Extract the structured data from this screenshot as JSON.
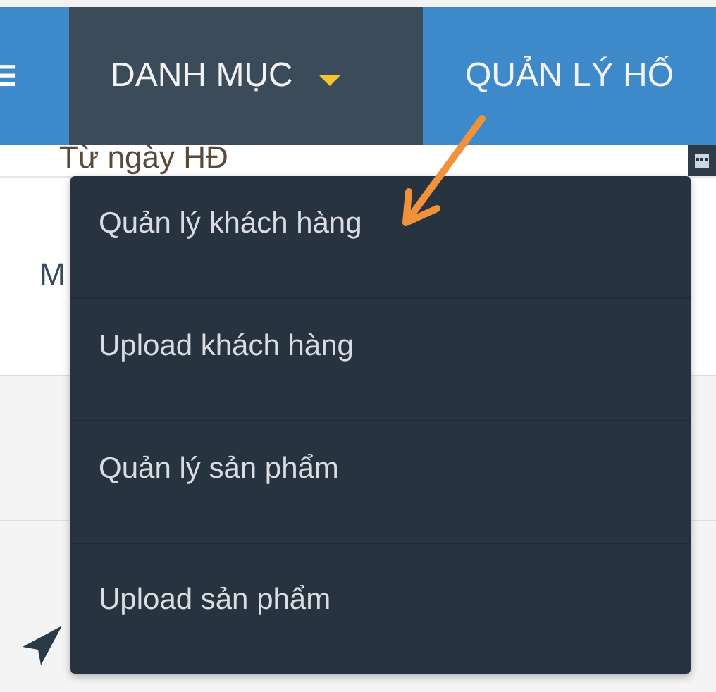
{
  "nav": {
    "tabs": [
      {
        "label": "DANH MỤC",
        "selected": true,
        "dropdown": true
      },
      {
        "label": "QUẢN LÝ HỐ",
        "selected": false,
        "dropdown": false
      }
    ]
  },
  "form": {
    "date_label": "Từ ngày HĐ",
    "field_2_label": "M"
  },
  "dropdown_menu": {
    "items": [
      {
        "label": "Quản lý khách hàng"
      },
      {
        "label": "Upload khách hàng"
      },
      {
        "label": "Quản lý sản phẩm"
      },
      {
        "label": "Upload sản phẩm"
      }
    ]
  }
}
